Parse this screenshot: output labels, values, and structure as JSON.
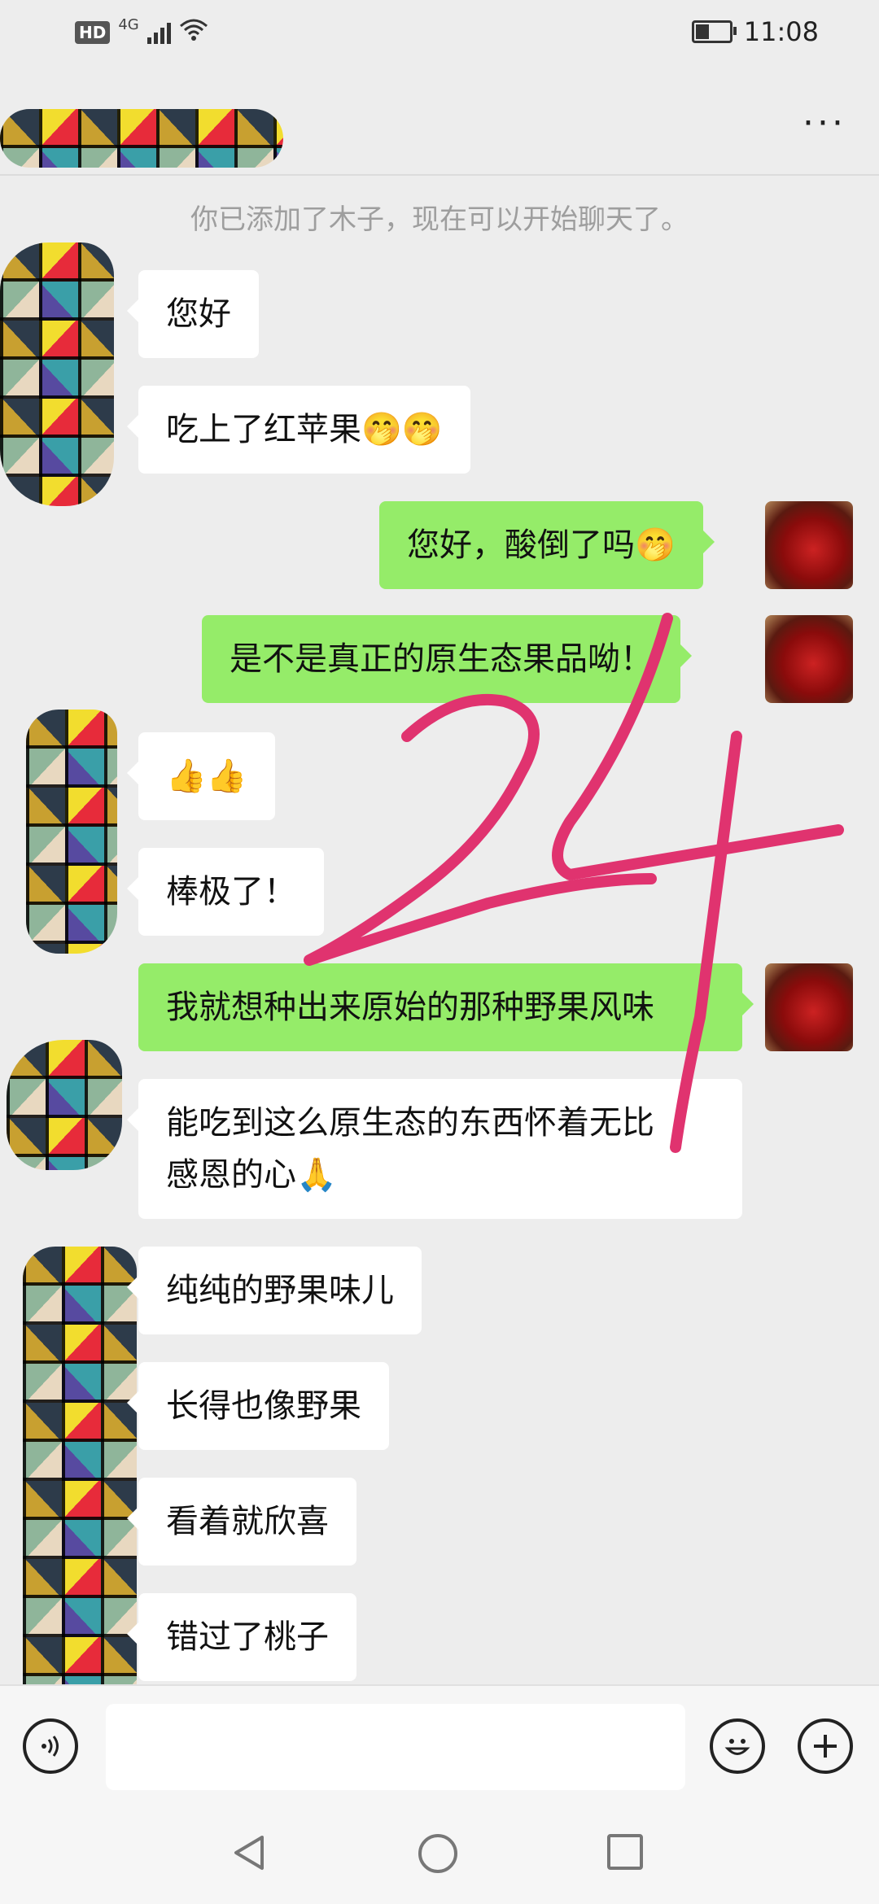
{
  "status_bar": {
    "hd": "HD",
    "network": "4G",
    "time": "11:08",
    "battery_level": 0.45
  },
  "header": {
    "more_label": "···"
  },
  "system_note": "你已添加了木子，现在可以开始聊天了。",
  "messages": [
    {
      "side": "in",
      "text": "您好"
    },
    {
      "side": "in",
      "text": "吃上了红苹果🤭🤭"
    },
    {
      "side": "out",
      "text": "您好，酸倒了吗🤭"
    },
    {
      "side": "out",
      "text": "是不是真正的原生态果品呦！"
    },
    {
      "side": "in",
      "text": "👍👍"
    },
    {
      "side": "in",
      "text": "棒极了！"
    },
    {
      "side": "out",
      "text": "我就想种出来原始的那种野果风味"
    },
    {
      "side": "in",
      "text": "能吃到这么原生态的东西怀着无比\n感恩的心🙏"
    },
    {
      "side": "in",
      "text": "纯纯的野果味儿"
    },
    {
      "side": "in",
      "text": "长得也像野果"
    },
    {
      "side": "in",
      "text": "看着就欣喜"
    },
    {
      "side": "in",
      "text": "错过了桃子"
    }
  ],
  "annotation": {
    "text": "24",
    "color": "#e0336f"
  },
  "input_bar": {
    "value": ""
  },
  "colors": {
    "background": "#ededed",
    "bubble_out": "#95ec69",
    "bubble_in": "#ffffff"
  }
}
